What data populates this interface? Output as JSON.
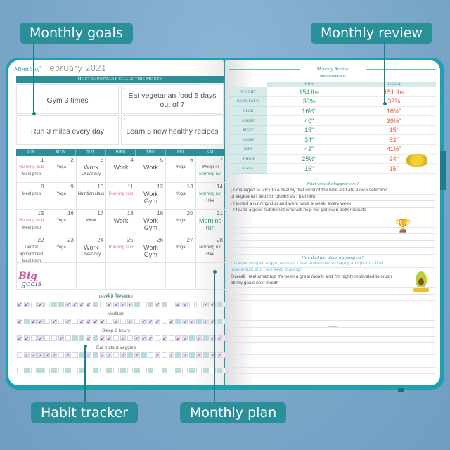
{
  "callouts": {
    "monthly_goals": "Monthly goals",
    "monthly_review": "Monthly review",
    "habit_tracker": "Habit tracker",
    "monthly_plan": "Monthly plan"
  },
  "left_page": {
    "month_of_label": "Month of",
    "month_value": "February 2021",
    "goals_header": "MOST IMPORTANT GOALS THIS MONTH",
    "goals": [
      {
        "num": "1",
        "text": "Gym 3 times"
      },
      {
        "num": "2",
        "text": "Eat vegetarian food 5 days out of 7"
      },
      {
        "num": "3",
        "text": "Run 3 miles every day"
      },
      {
        "num": "4",
        "text": "Learn 5 new healthy recipes"
      }
    ],
    "weekdays": [
      "SUN",
      "MON",
      "TUE",
      "WED",
      "THU",
      "FRI",
      "SAT"
    ],
    "days": [
      {
        "n": "1",
        "events": [
          {
            "t": "Running club",
            "c": "pink"
          },
          {
            "t": "Meal prep"
          }
        ]
      },
      {
        "n": "2",
        "events": [
          {
            "t": "Yoga"
          }
        ]
      },
      {
        "n": "3",
        "events": [
          {
            "t": "Work",
            "c": "big"
          },
          {
            "t": "Cheat day"
          }
        ]
      },
      {
        "n": "4",
        "events": [
          {
            "t": "Work",
            "c": "big"
          }
        ]
      },
      {
        "n": "5",
        "events": [
          {
            "t": "Work",
            "c": "big"
          }
        ]
      },
      {
        "n": "6",
        "events": [
          {
            "t": "Yoga"
          }
        ]
      },
      {
        "n": "7",
        "events": [
          {
            "t": "Weigh-in"
          },
          {
            "t": "Morning run",
            "c": "green"
          }
        ]
      },
      {
        "n": "8",
        "events": [
          {
            "t": "Meal prep"
          }
        ]
      },
      {
        "n": "9",
        "events": [
          {
            "t": "Yoga"
          }
        ]
      },
      {
        "n": "10",
        "events": [
          {
            "t": "Nutrition class"
          }
        ]
      },
      {
        "n": "11",
        "events": [
          {
            "t": "Running club",
            "c": "pink"
          }
        ]
      },
      {
        "n": "12",
        "events": [
          {
            "t": "Work",
            "c": "big"
          },
          {
            "t": "Gym",
            "c": "big"
          }
        ]
      },
      {
        "n": "13",
        "events": [
          {
            "t": "Yoga"
          }
        ]
      },
      {
        "n": "14",
        "events": [
          {
            "t": "Morning run",
            "c": "green"
          },
          {
            "t": "Hike"
          }
        ]
      },
      {
        "n": "15",
        "events": [
          {
            "t": "Running club",
            "c": "pink"
          },
          {
            "t": "Meal prep"
          }
        ]
      },
      {
        "n": "16",
        "events": [
          {
            "t": "Yoga"
          }
        ]
      },
      {
        "n": "17",
        "events": [
          {
            "t": "Work"
          }
        ]
      },
      {
        "n": "18",
        "events": [
          {
            "t": "Work",
            "c": "big"
          }
        ]
      },
      {
        "n": "19",
        "events": [
          {
            "t": "Work",
            "c": "big"
          },
          {
            "t": "Gym",
            "c": "big"
          }
        ]
      },
      {
        "n": "20",
        "events": [
          {
            "t": "Yoga"
          }
        ]
      },
      {
        "n": "21",
        "events": [
          {
            "t": "Morning run",
            "c": "green big"
          }
        ]
      },
      {
        "n": "22",
        "events": [
          {
            "t": "Dentist appointment"
          },
          {
            "t": "Meal prep"
          }
        ]
      },
      {
        "n": "23",
        "events": [
          {
            "t": "Yoga"
          }
        ]
      },
      {
        "n": "24",
        "events": [
          {
            "t": "Work",
            "c": "big"
          },
          {
            "t": "Cheat day"
          }
        ]
      },
      {
        "n": "25",
        "events": [
          {
            "t": "Running club",
            "c": "pink"
          }
        ]
      },
      {
        "n": "26",
        "events": [
          {
            "t": "Work",
            "c": "big"
          },
          {
            "t": "Gym",
            "c": "big"
          }
        ]
      },
      {
        "n": "27",
        "events": [
          {
            "t": "Yoga"
          }
        ]
      },
      {
        "n": "28",
        "events": [
          {
            "t": "Morning run"
          },
          {
            "t": "Hike"
          }
        ]
      },
      {
        "n": "",
        "events": []
      },
      {
        "n": "",
        "events": []
      },
      {
        "n": "",
        "events": []
      },
      {
        "n": "",
        "events": []
      },
      {
        "n": "",
        "events": []
      },
      {
        "n": "",
        "events": []
      },
      {
        "n": "",
        "events": []
      }
    ],
    "big_goals_logo": {
      "big": "Big",
      "goals": "goals"
    },
    "habit_tracker_title": "Habit Tracker",
    "habits": [
      {
        "name": "Drink 2 l of water",
        "cells": "cceceffccccfeccccfefcfecceeccfc"
      },
      {
        "name": "Meditate",
        "cells": "cfccecececcccecececccecfccfccfc"
      },
      {
        "name": "Sleep 8 hours",
        "cells": "cceceeceffcfccececccececcfcfccc"
      },
      {
        "name": "Eat fruits & veggies",
        "cells": "ecccccecefcfccecfcfececfcfcfccc"
      },
      {
        "name": "",
        "cells": "efefefefefefefefefefefefefefefe"
      }
    ]
  },
  "right_page": {
    "title": "Monthly Review",
    "subtitle": "Measurements",
    "columns": [
      "NOW",
      "RESULT"
    ],
    "measurements": [
      {
        "label": "WEIGHT",
        "now": "154 lbs",
        "result": "151 lbs"
      },
      {
        "label": "BODY FAT %",
        "now": "33%",
        "result": "32%"
      },
      {
        "label": "NECK",
        "now": "16½\"",
        "result": "16⅛\""
      },
      {
        "label": "CHEST",
        "now": "40\"",
        "result": "39½\""
      },
      {
        "label": "BICEP",
        "now": "15\"",
        "result": "15\""
      },
      {
        "label": "WAIST",
        "now": "34\"",
        "result": "32\""
      },
      {
        "label": "HIPS",
        "now": "42\"",
        "result": "41½\""
      },
      {
        "label": "THIGH",
        "now": "25½\"",
        "result": "24\""
      },
      {
        "label": "CALF",
        "now": "15\"",
        "result": "15\""
      }
    ],
    "wins_title": "What were the biggest wins?",
    "wins": [
      "- I managed to stick to a healthy diet most of the time and ate a nice selection",
      "of vegetarian and fish dishes as I planned",
      "- I joined a running club and went twice a week, every week",
      "- I found a good nutritionist who will help me get even better results"
    ],
    "progress_title": "How do I feel about my progress?",
    "progress": [
      {
        "t": "* I never skipped a gym workout - that makes me so happy and proud I built",
        "c": "blue"
      },
      {
        "t": "momentum and I will keep it going!",
        "c": "blue"
      },
      {
        "t": "Overall I feel amazing! It's been a great month and I'm highly motivated to crush",
        "c": ""
      },
      {
        "t": "all my goals next month",
        "c": ""
      }
    ],
    "notes_title": "Notes"
  }
}
